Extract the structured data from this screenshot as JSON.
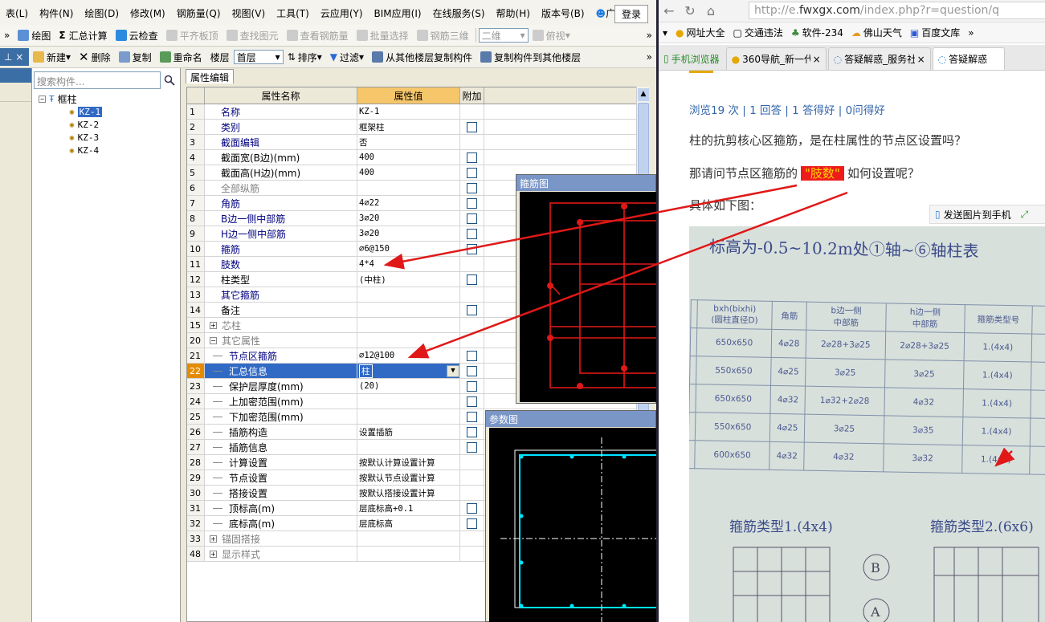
{
  "cad": {
    "menu": [
      "表(L)",
      "构件(N)",
      "绘图(D)",
      "修改(M)",
      "钢筋量(Q)",
      "视图(V)",
      "工具(T)",
      "云应用(Y)",
      "BIM应用(I)",
      "在线服务(S)",
      "帮助(H)",
      "版本号(B)",
      "广小二"
    ],
    "login": "登录",
    "toolbar1": [
      "绘图",
      "汇总计算",
      "云检查",
      "平齐板顶",
      "查找图元",
      "查看钢筋量",
      "批量选择",
      "钢筋三维",
      "二维",
      "俯视"
    ],
    "toolbar2": {
      "new": "新建",
      "delete": "删除",
      "copy": "复制",
      "rename": "重命名",
      "floor_label": "楼层",
      "floor_value": "首层",
      "sort": "排序",
      "filter": "过滤",
      "copy_from": "从其他楼层复制构件",
      "copy_to": "复制构件到其他楼层"
    },
    "search_placeholder": "搜索构件...",
    "tree": {
      "root": "框柱",
      "items": [
        "KZ-1",
        "KZ-2",
        "KZ-3",
        "KZ-4"
      ],
      "selected": "KZ-1"
    },
    "prop_tab": "属性编辑",
    "columns": {
      "name": "属性名称",
      "value": "属性值",
      "extra": "附加"
    },
    "rows": [
      {
        "no": "1",
        "name": "名称",
        "value": "KZ-1",
        "style": "blue",
        "chk": false
      },
      {
        "no": "2",
        "name": "类别",
        "value": "框架柱",
        "style": "blue",
        "chk": true
      },
      {
        "no": "3",
        "name": "截面编辑",
        "value": "否",
        "style": "blue",
        "chk": false
      },
      {
        "no": "4",
        "name": "截面宽(B边)(mm)",
        "value": "400",
        "style": "",
        "chk": true
      },
      {
        "no": "5",
        "name": "截面高(H边)(mm)",
        "value": "400",
        "style": "",
        "chk": true
      },
      {
        "no": "6",
        "name": "全部纵筋",
        "value": "",
        "style": "gray",
        "chk": true
      },
      {
        "no": "7",
        "name": "角筋",
        "value": "4⌀22",
        "style": "blue",
        "chk": true
      },
      {
        "no": "8",
        "name": "B边一侧中部筋",
        "value": "3⌀20",
        "style": "blue",
        "chk": true
      },
      {
        "no": "9",
        "name": "H边一侧中部筋",
        "value": "3⌀20",
        "style": "blue",
        "chk": true
      },
      {
        "no": "10",
        "name": "箍筋",
        "value": "⌀6@150",
        "style": "blue",
        "chk": true
      },
      {
        "no": "11",
        "name": "肢数",
        "value": "4*4",
        "style": "blue",
        "chk": false
      },
      {
        "no": "12",
        "name": "柱类型",
        "value": "(中柱)",
        "style": "",
        "chk": true
      },
      {
        "no": "13",
        "name": "其它箍筋",
        "value": "",
        "style": "blue",
        "chk": false
      },
      {
        "no": "14",
        "name": "备注",
        "value": "",
        "style": "",
        "chk": true
      },
      {
        "no": "15",
        "name": "芯柱",
        "value": "",
        "style": "gray",
        "chk": false,
        "exp": "+"
      },
      {
        "no": "20",
        "name": "其它属性",
        "value": "",
        "style": "gray",
        "chk": false,
        "exp": "−"
      },
      {
        "no": "21",
        "name": "节点区箍筋",
        "value": "⌀12@100",
        "style": "blue",
        "chk": true,
        "ind": true
      },
      {
        "no": "22",
        "name": "汇总信息",
        "value": "柱",
        "style": "",
        "chk": true,
        "ind": true,
        "hl": true
      },
      {
        "no": "23",
        "name": "保护层厚度(mm)",
        "value": "(20)",
        "style": "",
        "chk": true,
        "ind": true
      },
      {
        "no": "24",
        "name": "上加密范围(mm)",
        "value": "",
        "style": "",
        "chk": true,
        "ind": true
      },
      {
        "no": "25",
        "name": "下加密范围(mm)",
        "value": "",
        "style": "",
        "chk": true,
        "ind": true
      },
      {
        "no": "26",
        "name": "插筋构造",
        "value": "设置插筋",
        "style": "",
        "chk": true,
        "ind": true
      },
      {
        "no": "27",
        "name": "插筋信息",
        "value": "",
        "style": "",
        "chk": true,
        "ind": true
      },
      {
        "no": "28",
        "name": "计算设置",
        "value": "按默认计算设置计算",
        "style": "",
        "chk": false,
        "ind": true
      },
      {
        "no": "29",
        "name": "节点设置",
        "value": "按默认节点设置计算",
        "style": "",
        "chk": false,
        "ind": true
      },
      {
        "no": "30",
        "name": "搭接设置",
        "value": "按默认搭接设置计算",
        "style": "",
        "chk": false,
        "ind": true
      },
      {
        "no": "31",
        "name": "顶标高(m)",
        "value": "层底标高+0.1",
        "style": "",
        "chk": true,
        "ind": true
      },
      {
        "no": "32",
        "name": "底标高(m)",
        "value": "层底标高",
        "style": "",
        "chk": true,
        "ind": true
      },
      {
        "no": "33",
        "name": "锚固搭接",
        "value": "",
        "style": "gray",
        "chk": false,
        "exp": "+"
      },
      {
        "no": "48",
        "name": "显示样式",
        "value": "",
        "style": "gray",
        "chk": false,
        "exp": "+"
      }
    ],
    "panel_stirrup": "箍筋图",
    "panel_param": "参数图"
  },
  "browser": {
    "url_prefix": "http://e.",
    "url_domain": "fwxgx.com",
    "url_rest": "/index.php?r=question/q",
    "favorites": [
      "网址大全",
      "交通违法",
      "软件-234",
      "佛山天气",
      "百度文库"
    ],
    "tabs": [
      "手机浏览器",
      "360导航_新一代",
      "答疑解惑_服务社",
      "答疑解惑"
    ],
    "stats": "浏览19 次 | 1 回答 | 1 答得好 | 0问得好",
    "q1": "柱的抗剪核心区箍筋，是在柱属性的节点区设置吗？",
    "q2a": "那请问节点区箍筋的",
    "q2b": "\"肢数\"",
    "q2c": "如何设置呢？",
    "q3": "具体如下图：",
    "send": "发送图片到手机",
    "photo": {
      "title": "标高为-0.5~10.2m处①轴~⑥轴柱表",
      "headers": [
        "bxh(bixhi)\n(圆柱直径D)",
        "角筋",
        "b边一侧\n中部筋",
        "h边一侧\n中部筋",
        "箍筋类型号"
      ],
      "rows": [
        [
          "650x650",
          "4⌀28",
          "2⌀28+3⌀25",
          "2⌀28+3⌀25",
          "1.(4x4)"
        ],
        [
          "550x650",
          "4⌀25",
          "3⌀25",
          "3⌀25",
          "1.(4x4)"
        ],
        [
          "650x650",
          "4⌀32",
          "1⌀32+2⌀28",
          "4⌀32",
          "1.(4x4)"
        ],
        [
          "550x650",
          "4⌀25",
          "3⌀25",
          "3⌀35",
          "1.(4x4)"
        ],
        [
          "600x650",
          "4⌀32",
          "4⌀32",
          "3⌀32",
          "1.(4x4)"
        ]
      ],
      "cap1": "箍筋类型1.(4x4)",
      "cap2": "箍筋类型2.(6x6)"
    }
  },
  "colors": {
    "accent": "#316ac5",
    "red": "#ee1b1b",
    "cyan": "#00e5ff"
  }
}
